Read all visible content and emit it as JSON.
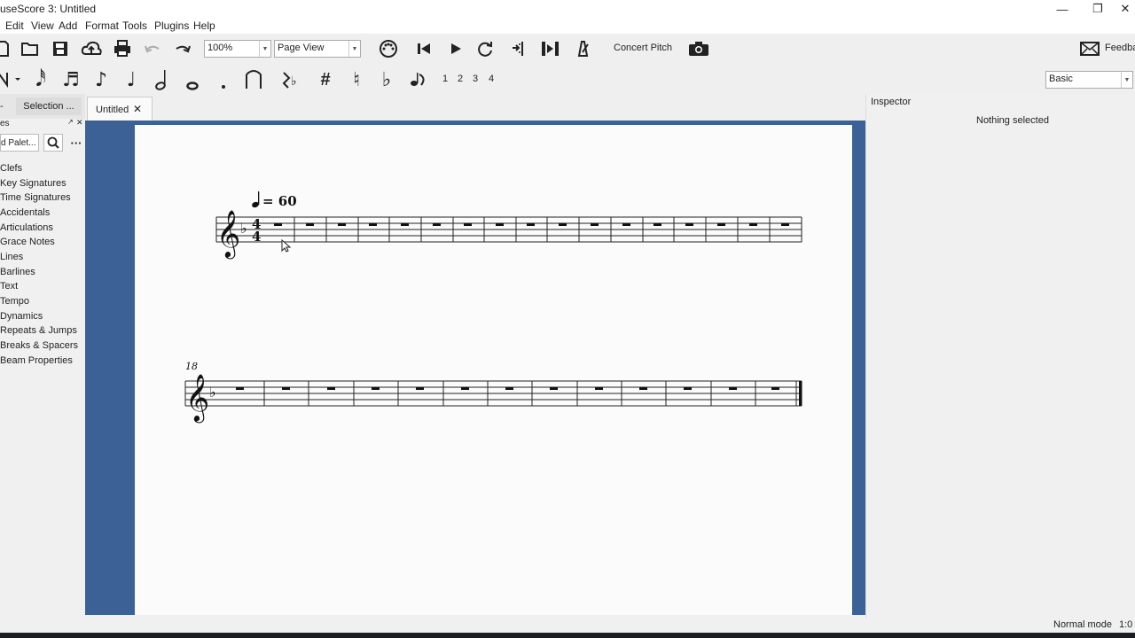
{
  "window": {
    "title": "useScore 3: Untitled"
  },
  "menu": [
    "Edit",
    "View",
    "Add",
    "Format",
    "Tools",
    "Plugins",
    "Help"
  ],
  "toolbar": {
    "zoom": "100%",
    "view_mode": "Page View",
    "concert_pitch": "Concert Pitch",
    "feedback": "Feedba"
  },
  "note_input": {
    "voices": [
      "1",
      "2",
      "3",
      "4"
    ],
    "workspace": "Basic"
  },
  "palettes": {
    "header_fragment": "es",
    "selection_tab": "Selection ...",
    "add_palette_btn": "d Palet...",
    "items": [
      "Clefs",
      "Key Signatures",
      "Time Signatures",
      "Accidentals",
      "Articulations",
      "Grace Notes",
      "Lines",
      "Barlines",
      "Text",
      "Tempo",
      "Dynamics",
      "Repeats & Jumps",
      "Breaks & Spacers",
      "Beam Properties"
    ]
  },
  "score_tab": {
    "label": "Untitled"
  },
  "score": {
    "tempo_text": "= 60",
    "system2_measure_number": "18",
    "time_signature": [
      "4",
      "4"
    ]
  },
  "inspector": {
    "title": "Inspector",
    "empty_text": "Nothing selected"
  },
  "status": {
    "mode": "Normal mode",
    "position": "1:0"
  },
  "colors": {
    "canvas_bg": "#3c6196",
    "page_bg": "#fbfbfb"
  }
}
